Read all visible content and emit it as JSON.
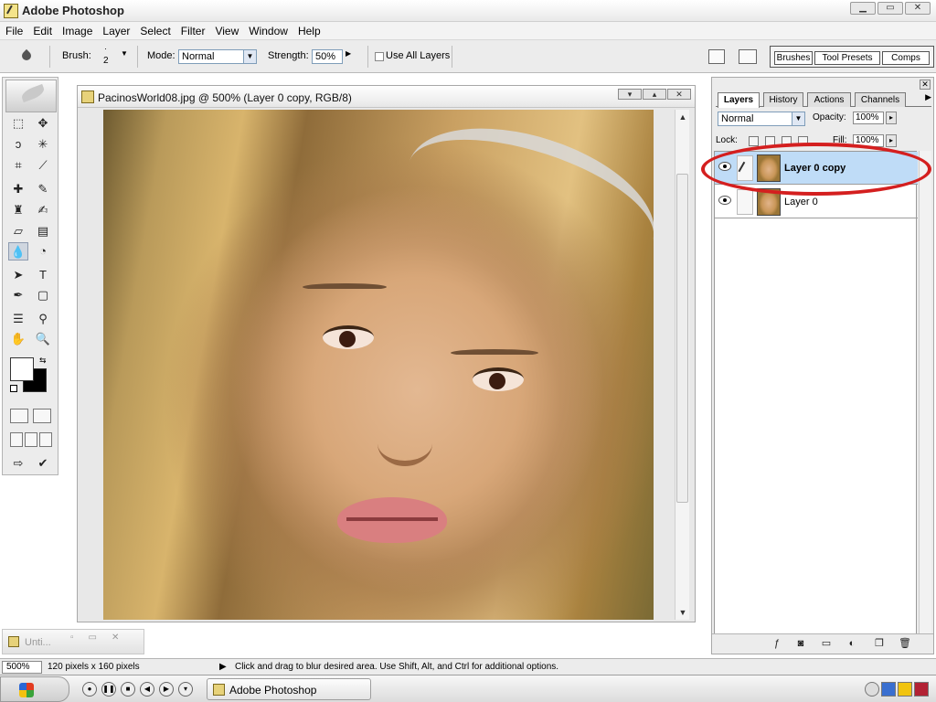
{
  "window": {
    "title": "Adobe Photoshop"
  },
  "menu": [
    "File",
    "Edit",
    "Image",
    "Layer",
    "Select",
    "Filter",
    "View",
    "Window",
    "Help"
  ],
  "options": {
    "brush_label": "Brush:",
    "brush_size": "2",
    "mode_label": "Mode:",
    "mode_value": "Normal",
    "strength_label": "Strength:",
    "strength_value": "50%",
    "use_all_layers": "Use All Layers",
    "use_all_layers_checked": false,
    "panel_well_tabs": [
      "Brushes",
      "Tool Presets",
      "Comps"
    ]
  },
  "document": {
    "title": "PacinosWorld08.jpg @ 500% (Layer 0 copy, RGB/8)"
  },
  "minimized_doc": {
    "label": "Unti..."
  },
  "layers_palette": {
    "tabs": [
      "Layers",
      "History",
      "Actions",
      "Channels"
    ],
    "active_tab": "Layers",
    "blend_mode": "Normal",
    "opacity_label": "Opacity:",
    "opacity_value": "100%",
    "lock_label": "Lock:",
    "fill_label": "Fill:",
    "fill_value": "100%",
    "layers": [
      {
        "name": "Layer 0 copy",
        "selected": true,
        "visible": true
      },
      {
        "name": "Layer 0",
        "selected": false,
        "visible": true
      }
    ]
  },
  "status": {
    "zoom": "500%",
    "dimensions": "120 pixels x 160 pixels",
    "message": "Click and drag to blur desired area.  Use Shift, Alt, and Ctrl for additional options."
  },
  "taskbar": {
    "items": [
      "Adobe Photoshop"
    ]
  },
  "colors": {
    "highlight_ring": "#d41f1f",
    "selected_layer_bg": "#bfdcf7",
    "foreground": "#ffffff",
    "background": "#000000"
  }
}
